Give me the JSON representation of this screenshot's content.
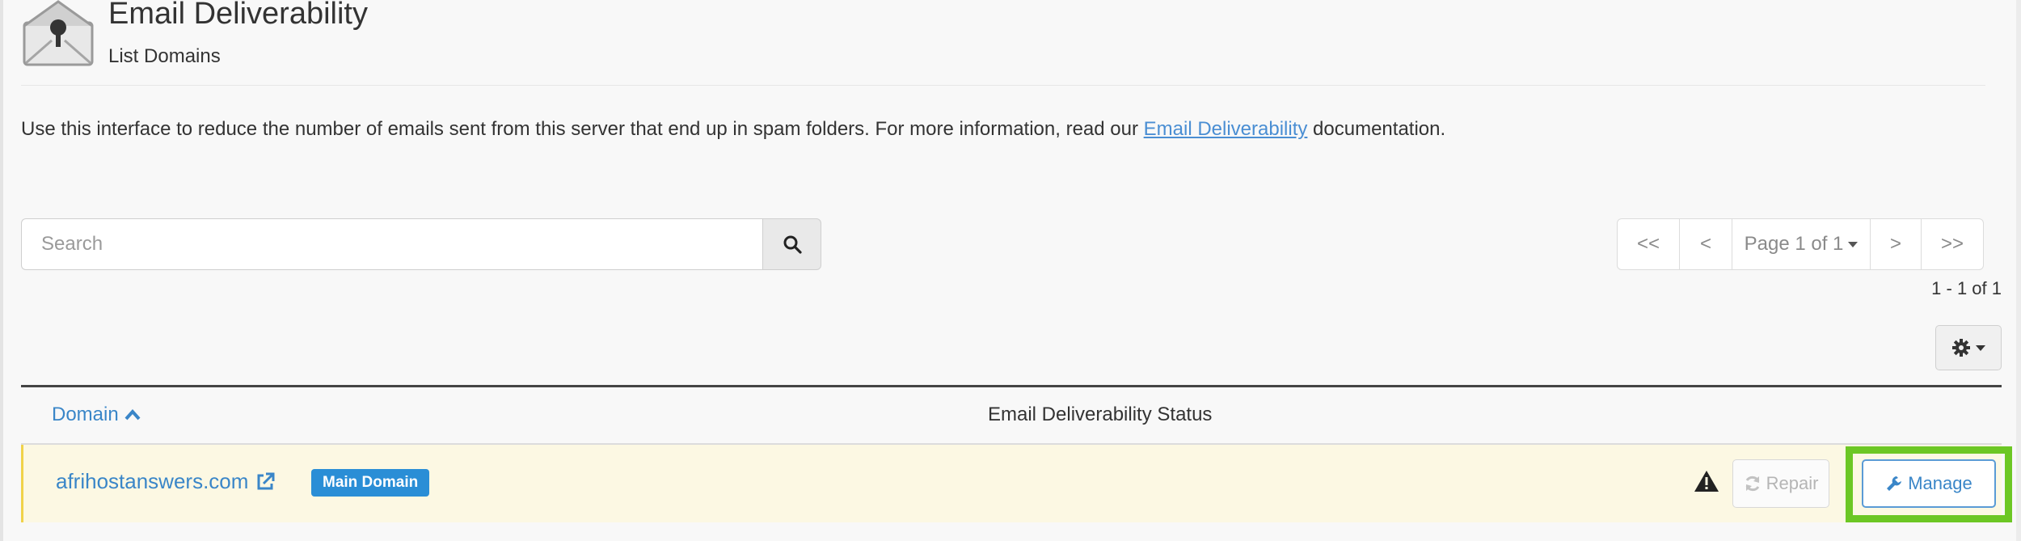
{
  "header": {
    "title": "Email Deliverability",
    "subtitle": "List Domains",
    "icon": "envelope-key-icon"
  },
  "description": {
    "text_before": "Use this interface to reduce the number of emails sent from this server that end up in spam folders. For more information, read our ",
    "link_text": "Email Deliverability",
    "text_after": " documentation."
  },
  "search": {
    "placeholder": "Search",
    "value": "",
    "icon": "search-icon"
  },
  "pagination": {
    "first_label": "<<",
    "prev_label": "<",
    "page_label": "Page 1 of 1",
    "next_label": ">",
    "last_label": ">>",
    "count_text": "1 - 1 of 1"
  },
  "settings": {
    "icon": "gear-icon"
  },
  "table": {
    "columns": {
      "domain": "Domain",
      "status": "Email Deliverability Status"
    },
    "rows": [
      {
        "domain": "afrihostanswers.com",
        "badge": "Main Domain",
        "status_icon": "warning-icon",
        "repair_label": "Repair",
        "manage_label": "Manage"
      }
    ]
  },
  "colors": {
    "link": "#3a86c8",
    "badge": "#2a8ed6",
    "row_highlight": "#fcf8e3",
    "highlight_box": "#6cc724"
  }
}
